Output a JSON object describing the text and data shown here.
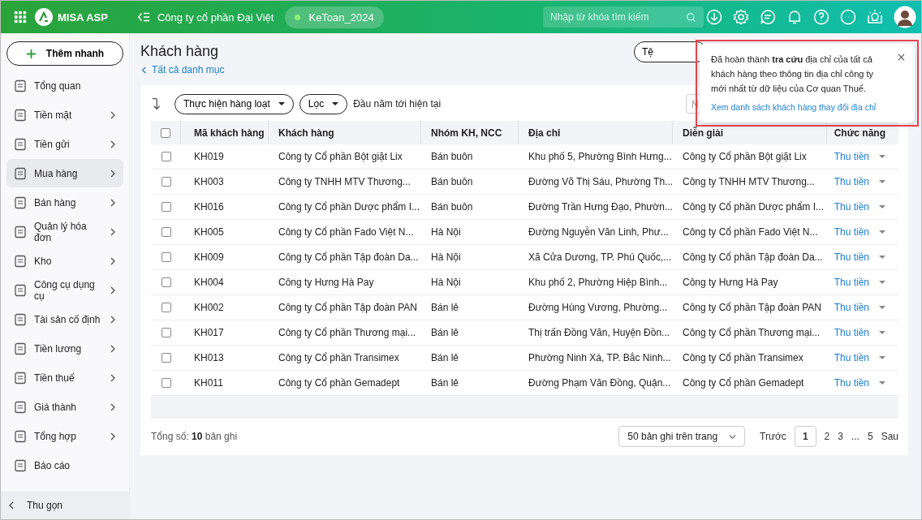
{
  "topbar": {
    "brand": "MISA ASP",
    "company": "Công ty cổ phần Đại Việt",
    "database": "KeToan_2024",
    "search": {
      "placeholder": "Nhập từ khóa tìm kiếm"
    }
  },
  "sidebar": {
    "quick_add": "Thêm nhanh",
    "items": [
      {
        "label": "Tổng quan",
        "has_submenu": false,
        "selected": false
      },
      {
        "label": "Tiền mặt",
        "has_submenu": true,
        "selected": false
      },
      {
        "label": "Tiền gửi",
        "has_submenu": true,
        "selected": false
      },
      {
        "label": "Mua hàng",
        "has_submenu": true,
        "selected": true
      },
      {
        "label": "Bán hàng",
        "has_submenu": true,
        "selected": false
      },
      {
        "label": "Quản lý hóa đơn",
        "has_submenu": true,
        "selected": false
      },
      {
        "label": "Kho",
        "has_submenu": true,
        "selected": false
      },
      {
        "label": "Công cụ dụng cụ",
        "has_submenu": true,
        "selected": false
      },
      {
        "label": "Tài sản cố định",
        "has_submenu": true,
        "selected": false
      },
      {
        "label": "Tiền lương",
        "has_submenu": true,
        "selected": false
      },
      {
        "label": "Tiền thuế",
        "has_submenu": true,
        "selected": false
      },
      {
        "label": "Giá thành",
        "has_submenu": true,
        "selected": false
      },
      {
        "label": "Tổng hợp",
        "has_submenu": true,
        "selected": false
      },
      {
        "label": "Báo cáo",
        "has_submenu": false,
        "selected": false
      }
    ],
    "collapse": "Thu gọn"
  },
  "page": {
    "title": "Khách hàng",
    "back_link": "Tất cả danh mục",
    "header_button": "Tệ"
  },
  "toolbar": {
    "bulk_action": "Thực hiện hàng loạt",
    "filter": "Lọc",
    "period": "Đầu năm tới hiện tại",
    "search_placeholder": "N"
  },
  "table": {
    "select_all": {
      "checked": false
    },
    "columns": [
      "Mã khách hàng",
      "Khách hàng",
      "Nhóm KH, NCC",
      "Địa chỉ",
      "Diễn giải",
      "Chức năng"
    ],
    "rows": [
      {
        "checked": false,
        "code": "KH019",
        "name": "Công ty Cổ phần Bột giặt Lix",
        "group": "Bán buôn",
        "address": "Khu phố 5, Phường Bình Hưng...",
        "description": "Công ty Cổ phần Bột giặt Lix",
        "action": "Thu tiền"
      },
      {
        "checked": false,
        "code": "KH003",
        "name": "Công ty TNHH MTV Thương...",
        "group": "Bán buôn",
        "address": "Đường Võ Thị Sáu, Phường Th...",
        "description": "Công ty TNHH MTV Thương...",
        "action": "Thu tiền"
      },
      {
        "checked": false,
        "code": "KH016",
        "name": "Công ty Cổ phần Dược phẩm I...",
        "group": "Bán buôn",
        "address": "Đường Trần Hưng Đạo, Phườn...",
        "description": "Công ty Cổ phần Dược phẩm I...",
        "action": "Thu tiền"
      },
      {
        "checked": false,
        "code": "KH005",
        "name": "Công ty Cổ phần Fado Việt N...",
        "group": "Hà Nội",
        "address": "Đường Nguyễn Văn Linh, Phư...",
        "description": "Công ty Cổ phần Fado Việt N...",
        "action": "Thu tiền"
      },
      {
        "checked": false,
        "code": "KH009",
        "name": "Công ty Cổ phần Tập đoàn Da...",
        "group": "Hà Nội",
        "address": "Xã Cửa Dương, TP. Phú Quốc,...",
        "description": "Công ty Cổ phần Tập đoàn Da...",
        "action": "Thu tiền"
      },
      {
        "checked": false,
        "code": "KH004",
        "name": "Công ty Hưng Hà Pay",
        "group": "Hà Nội",
        "address": "Khu phố 2, Phường Hiệp Bình...",
        "description": "Công ty Hưng Hà Pay",
        "action": "Thu tiền"
      },
      {
        "checked": false,
        "code": "KH002",
        "name": "Công ty Cổ phần Tập đoàn PAN",
        "group": "Bán lẻ",
        "address": "Đường Hùng Vương, Phường...",
        "description": "Công ty Cổ phần Tập đoàn PAN",
        "action": "Thu tiền"
      },
      {
        "checked": false,
        "code": "KH017",
        "name": "Công ty Cổ phần Thương mại...",
        "group": "Bán lẻ",
        "address": "Thị trấn Đồng Văn, Huyện Đồn...",
        "description": "Công ty Cổ phần Thương mại...",
        "action": "Thu tiền"
      },
      {
        "checked": false,
        "code": "KH013",
        "name": "Công ty Cổ phần Transimex",
        "group": "Bán lẻ",
        "address": "Phường Ninh Xá, TP. Bắc Ninh...",
        "description": "Công ty Cổ phần Transimex",
        "action": "Thu tiền"
      },
      {
        "checked": false,
        "code": "KH011",
        "name": "Công ty Cổ phần Gemadept",
        "group": "Bán lẻ",
        "address": "Đường Phạm Văn Đồng, Quận...",
        "description": "Công ty Cổ phần Gemadept",
        "action": "Thu tiền"
      }
    ]
  },
  "footer": {
    "total_label": "Tổng số:",
    "total": "10",
    "total_unit": "bản ghi",
    "page_size": "50 bản ghi trên trang",
    "prev": "Trước",
    "pages": [
      {
        "label": "1",
        "selected": true
      },
      {
        "label": "2",
        "selected": false
      },
      {
        "label": "3",
        "selected": false
      },
      {
        "label": "...",
        "selected": false
      },
      {
        "label": "5",
        "selected": false
      }
    ],
    "next": "Sau"
  },
  "notification": {
    "message": "Đã hoàn thành **tra cứu** địa chỉ của tất cả khách hàng theo thông tin địa chỉ công ty mới nhất từ dữ liệu của Cơ quan Thuế.",
    "link": "Xem danh sách khách hàng thay đổi địa chỉ",
    "highlighted": true
  }
}
